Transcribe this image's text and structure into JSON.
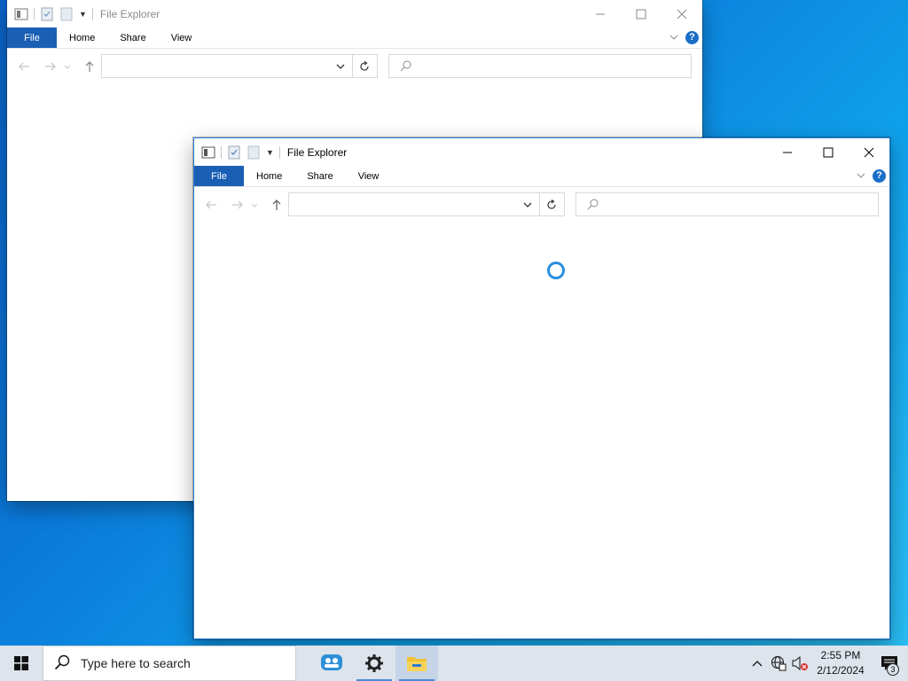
{
  "windows": [
    {
      "id": "back",
      "title": "File Explorer",
      "ribbon_tabs": [
        "File",
        "Home",
        "Share",
        "View"
      ],
      "address_value": "",
      "search_placeholder": "",
      "state": "inactive"
    },
    {
      "id": "front",
      "title": "File Explorer",
      "ribbon_tabs": [
        "File",
        "Home",
        "Share",
        "View"
      ],
      "address_value": "",
      "search_placeholder": "",
      "state": "active",
      "loading": true
    }
  ],
  "help_label": "?",
  "taskbar": {
    "search_placeholder": "Type here to search",
    "apps": [
      "people-icon",
      "settings-gear-icon",
      "file-explorer-icon"
    ],
    "active_app": "file-explorer-icon",
    "clock_time": "2:55 PM",
    "clock_date": "2/12/2024",
    "notification_count": "3"
  },
  "colors": {
    "accent": "#1a5fb4",
    "spinner": "#2b8fe0",
    "taskbar_bg": "#dde4ec"
  }
}
